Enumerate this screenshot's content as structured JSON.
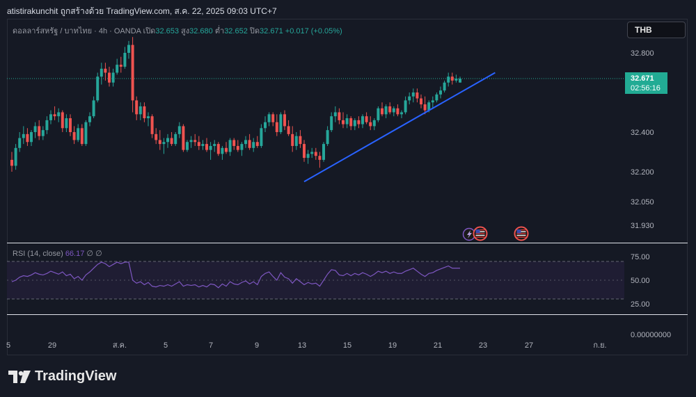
{
  "header": {
    "text": "atistirakunchit ถูกสร้างด้วย TradingView.com, ส.ค. 22, 2025 09:03 UTC+7"
  },
  "legend": {
    "symbol": "ดอลลาร์สหรัฐ / บาทไทย · 4h · OANDA",
    "open_label": "เปิด",
    "open": "32.653",
    "high_label": "สูง",
    "high": "32.680",
    "low_label": "ต่ำ",
    "low": "32.652",
    "close_label": "ปิด",
    "close": "32.671",
    "change": "+0.017 (+0.05%)"
  },
  "currency_button": "THB",
  "price_label": {
    "price": "32.671",
    "countdown": "02:56:16"
  },
  "rsi_legend": {
    "title": "RSI (14, close)",
    "value": "66.17",
    "v1": "∅",
    "v2": "∅"
  },
  "brand": "TradingView",
  "colors": {
    "up": "#26a69a",
    "down": "#ef5350",
    "trendline": "#2962ff",
    "rsi": "#7e57c2"
  },
  "icons": [
    "lightning-icon",
    "us-flag-icon",
    "us-flag-icon"
  ],
  "chart_data": {
    "type": "candlestick",
    "price_axis_ticks": [
      "32.800",
      "32.400",
      "32.200",
      "32.050",
      "31.930"
    ],
    "rsi_axis_ticks": [
      "75.00",
      "50.00",
      "25.00",
      "0.00000000"
    ],
    "x_ticks": [
      "5",
      "29",
      "ส.ค.",
      "5",
      "7",
      "9",
      "13",
      "15",
      "19",
      "21",
      "23",
      "27",
      "ก.ย."
    ],
    "ylim": [
      31.9,
      32.95
    ],
    "rsi_ylim": [
      0,
      100
    ],
    "candles": [
      [
        32.26,
        32.3,
        32.2,
        32.23
      ],
      [
        32.23,
        32.34,
        32.21,
        32.32
      ],
      [
        32.32,
        32.4,
        32.3,
        32.37
      ],
      [
        32.37,
        32.43,
        32.34,
        32.39
      ],
      [
        32.39,
        32.42,
        32.33,
        32.35
      ],
      [
        32.35,
        32.41,
        32.33,
        32.4
      ],
      [
        32.4,
        32.45,
        32.37,
        32.43
      ],
      [
        32.43,
        32.46,
        32.36,
        32.38
      ],
      [
        32.38,
        32.43,
        32.36,
        32.41
      ],
      [
        32.41,
        32.48,
        32.39,
        32.46
      ],
      [
        32.46,
        32.51,
        32.44,
        32.49
      ],
      [
        32.49,
        32.53,
        32.46,
        32.48
      ],
      [
        32.48,
        32.52,
        32.45,
        32.5
      ],
      [
        32.5,
        32.51,
        32.4,
        32.42
      ],
      [
        32.42,
        32.49,
        32.4,
        32.47
      ],
      [
        32.47,
        32.49,
        32.38,
        32.4
      ],
      [
        32.4,
        32.43,
        32.34,
        32.36
      ],
      [
        32.36,
        32.44,
        32.35,
        32.42
      ],
      [
        32.42,
        32.44,
        32.33,
        32.34
      ],
      [
        32.34,
        32.46,
        32.33,
        32.45
      ],
      [
        32.45,
        32.5,
        32.43,
        32.48
      ],
      [
        32.48,
        32.58,
        32.47,
        32.56
      ],
      [
        32.56,
        32.7,
        32.55,
        32.68
      ],
      [
        32.68,
        32.75,
        32.64,
        32.72
      ],
      [
        32.72,
        32.75,
        32.66,
        32.7
      ],
      [
        32.7,
        32.73,
        32.63,
        32.65
      ],
      [
        32.65,
        32.72,
        32.63,
        32.7
      ],
      [
        32.7,
        32.77,
        32.69,
        32.74
      ],
      [
        32.74,
        32.78,
        32.7,
        32.73
      ],
      [
        32.73,
        32.83,
        32.72,
        32.8
      ],
      [
        32.8,
        32.86,
        32.77,
        32.84
      ],
      [
        32.84,
        32.88,
        32.5,
        32.56
      ],
      [
        32.56,
        32.58,
        32.46,
        32.49
      ],
      [
        32.49,
        32.55,
        32.46,
        32.53
      ],
      [
        32.53,
        32.55,
        32.45,
        32.47
      ],
      [
        32.47,
        32.5,
        32.43,
        32.48
      ],
      [
        32.48,
        32.49,
        32.37,
        32.39
      ],
      [
        32.39,
        32.42,
        32.34,
        32.36
      ],
      [
        32.36,
        32.41,
        32.31,
        32.34
      ],
      [
        32.34,
        32.37,
        32.29,
        32.35
      ],
      [
        32.35,
        32.39,
        32.32,
        32.37
      ],
      [
        32.37,
        32.4,
        32.33,
        32.34
      ],
      [
        32.34,
        32.4,
        32.33,
        32.39
      ],
      [
        32.39,
        32.45,
        32.37,
        32.43
      ],
      [
        32.43,
        32.44,
        32.3,
        32.31
      ],
      [
        32.31,
        32.36,
        32.3,
        32.35
      ],
      [
        32.35,
        32.38,
        32.32,
        32.36
      ],
      [
        32.36,
        32.39,
        32.33,
        32.35
      ],
      [
        32.35,
        32.38,
        32.31,
        32.33
      ],
      [
        32.33,
        32.36,
        32.31,
        32.34
      ],
      [
        32.34,
        32.37,
        32.3,
        32.31
      ],
      [
        32.31,
        32.35,
        32.26,
        32.33
      ],
      [
        32.33,
        32.36,
        32.3,
        32.34
      ],
      [
        32.34,
        32.35,
        32.28,
        32.29
      ],
      [
        32.29,
        32.33,
        32.26,
        32.32
      ],
      [
        32.32,
        32.35,
        32.29,
        32.3
      ],
      [
        32.3,
        32.37,
        32.28,
        32.36
      ],
      [
        32.36,
        32.37,
        32.31,
        32.33
      ],
      [
        32.33,
        32.36,
        32.3,
        32.31
      ],
      [
        32.31,
        32.35,
        32.28,
        32.34
      ],
      [
        32.34,
        32.38,
        32.32,
        32.36
      ],
      [
        32.36,
        32.39,
        32.31,
        32.32
      ],
      [
        32.32,
        32.37,
        32.3,
        32.35
      ],
      [
        32.35,
        32.38,
        32.32,
        32.33
      ],
      [
        32.33,
        32.44,
        32.32,
        32.42
      ],
      [
        32.42,
        32.48,
        32.4,
        32.45
      ],
      [
        32.45,
        32.5,
        32.43,
        32.49
      ],
      [
        32.49,
        32.5,
        32.43,
        32.45
      ],
      [
        32.45,
        32.49,
        32.38,
        32.4
      ],
      [
        32.4,
        32.5,
        32.39,
        32.49
      ],
      [
        32.49,
        32.51,
        32.41,
        32.43
      ],
      [
        32.43,
        32.46,
        32.38,
        32.39
      ],
      [
        32.39,
        32.43,
        32.3,
        32.33
      ],
      [
        32.33,
        32.4,
        32.31,
        32.38
      ],
      [
        32.38,
        32.41,
        32.32,
        32.34
      ],
      [
        32.34,
        32.36,
        32.25,
        32.27
      ],
      [
        32.27,
        32.31,
        32.24,
        32.29
      ],
      [
        32.29,
        32.32,
        32.27,
        32.3
      ],
      [
        32.3,
        32.32,
        32.26,
        32.28
      ],
      [
        32.28,
        32.3,
        32.22,
        32.26
      ],
      [
        32.26,
        32.35,
        32.25,
        32.34
      ],
      [
        32.34,
        32.43,
        32.33,
        32.41
      ],
      [
        32.41,
        32.5,
        32.4,
        32.48
      ],
      [
        32.48,
        32.53,
        32.45,
        32.5
      ],
      [
        32.5,
        32.52,
        32.44,
        32.46
      ],
      [
        32.46,
        32.5,
        32.42,
        32.44
      ],
      [
        32.44,
        32.49,
        32.42,
        32.47
      ],
      [
        32.47,
        32.48,
        32.41,
        32.43
      ],
      [
        32.43,
        32.47,
        32.41,
        32.46
      ],
      [
        32.46,
        32.48,
        32.42,
        32.44
      ],
      [
        32.44,
        32.49,
        32.42,
        32.48
      ],
      [
        32.48,
        32.5,
        32.44,
        32.45
      ],
      [
        32.45,
        32.48,
        32.41,
        32.43
      ],
      [
        32.43,
        32.47,
        32.41,
        32.46
      ],
      [
        32.46,
        32.53,
        32.45,
        32.52
      ],
      [
        32.52,
        32.55,
        32.48,
        32.49
      ],
      [
        32.49,
        32.54,
        32.47,
        32.53
      ],
      [
        32.53,
        32.55,
        32.49,
        32.5
      ],
      [
        32.5,
        32.53,
        32.48,
        32.52
      ],
      [
        32.52,
        32.54,
        32.48,
        32.49
      ],
      [
        32.49,
        32.51,
        32.47,
        32.5
      ],
      [
        32.5,
        32.58,
        32.49,
        32.56
      ],
      [
        32.56,
        32.6,
        32.54,
        32.58
      ],
      [
        32.58,
        32.62,
        32.55,
        32.6
      ],
      [
        32.6,
        32.62,
        32.55,
        32.57
      ],
      [
        32.57,
        32.59,
        32.52,
        32.54
      ],
      [
        32.54,
        32.58,
        32.49,
        32.51
      ],
      [
        32.51,
        32.56,
        32.5,
        32.55
      ],
      [
        32.55,
        32.58,
        32.52,
        32.56
      ],
      [
        32.56,
        32.6,
        32.55,
        32.59
      ],
      [
        32.59,
        32.63,
        32.57,
        32.61
      ],
      [
        32.61,
        32.66,
        32.6,
        32.65
      ],
      [
        32.65,
        32.7,
        32.63,
        32.68
      ],
      [
        32.68,
        32.7,
        32.64,
        32.66
      ],
      [
        32.66,
        32.69,
        32.65,
        32.67
      ],
      [
        32.65,
        32.68,
        32.65,
        32.67
      ]
    ],
    "trendline": {
      "start": [
        75,
        32.15
      ],
      "end": [
        124,
        32.7
      ]
    },
    "rsi": [
      48,
      50,
      54,
      56,
      55,
      57,
      60,
      58,
      57,
      59,
      62,
      60,
      58,
      61,
      56,
      58,
      52,
      55,
      50,
      57,
      61,
      66,
      71,
      74,
      72,
      68,
      71,
      74,
      72,
      74,
      74,
      50,
      46,
      48,
      44,
      47,
      42,
      41,
      43,
      42,
      44,
      42,
      45,
      48,
      42,
      44,
      43,
      44,
      41,
      43,
      41,
      45,
      44,
      40,
      45,
      42,
      48,
      45,
      44,
      47,
      49,
      45,
      48,
      44,
      55,
      59,
      61,
      55,
      50,
      60,
      54,
      52,
      46,
      52,
      48,
      44,
      47,
      45,
      46,
      42,
      50,
      58,
      64,
      63,
      57,
      56,
      59,
      56,
      59,
      57,
      60,
      58,
      55,
      58,
      62,
      60,
      62,
      59,
      61,
      59,
      59,
      62,
      64,
      66,
      62,
      58,
      55,
      59,
      60,
      63,
      65,
      67,
      69,
      66,
      66,
      66
    ],
    "annotations": [
      "lightning",
      "us-flag",
      "us-flag"
    ]
  }
}
